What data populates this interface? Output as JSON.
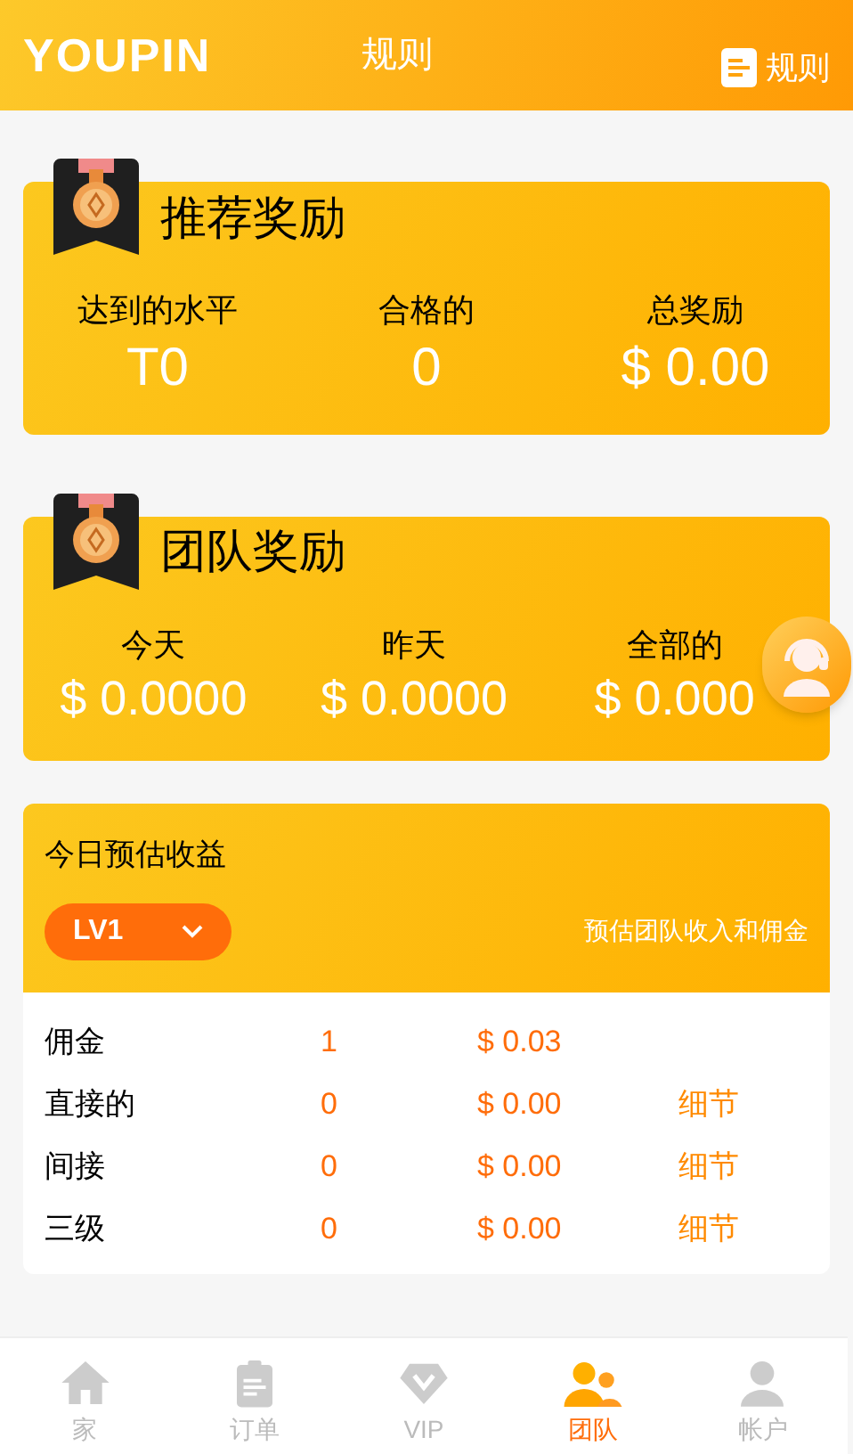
{
  "header": {
    "logo": "YOUPIN",
    "title": "规则",
    "rules_link": "规则"
  },
  "referral": {
    "title": "推荐奖励",
    "stats": [
      {
        "label": "达到的水平",
        "value": "T0"
      },
      {
        "label": "合格的",
        "value": "0"
      },
      {
        "label": "总奖励",
        "value": "$ 0.00"
      }
    ]
  },
  "team": {
    "title": "团队奖励",
    "stats": [
      {
        "label": "今天",
        "value": "$ 0.0000"
      },
      {
        "label": "昨天",
        "value": "$ 0.0000"
      },
      {
        "label": "全部的",
        "value": "$ 0.000"
      }
    ]
  },
  "estimate": {
    "title": "今日预估收益",
    "level": "LV1",
    "note": "预估团队收入和佣金",
    "rows": [
      {
        "label": "佣金",
        "count": "1",
        "amount": "$ 0.03"
      },
      {
        "label": "直接的",
        "count": "0",
        "amount": "$ 0.00",
        "link": "细节"
      },
      {
        "label": "间接",
        "count": "0",
        "amount": "$ 0.00",
        "link": "细节"
      },
      {
        "label": "三级",
        "count": "0",
        "amount": "$ 0.00",
        "link": "细节"
      }
    ]
  },
  "nav": [
    {
      "kind": "home",
      "label": "家",
      "selected": false
    },
    {
      "kind": "orders",
      "label": "订单",
      "selected": false
    },
    {
      "kind": "vip",
      "label": "VIP",
      "selected": false
    },
    {
      "kind": "team",
      "label": "团队",
      "selected": true
    },
    {
      "kind": "account",
      "label": "帐户",
      "selected": false
    }
  ]
}
